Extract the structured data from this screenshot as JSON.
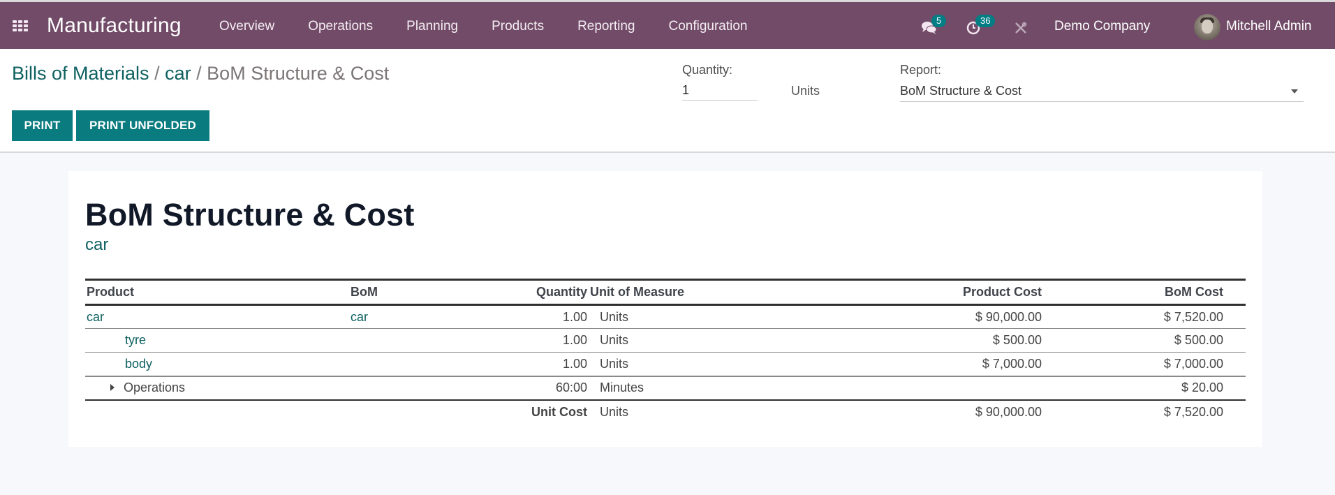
{
  "navbar": {
    "app_name": "Manufacturing",
    "menu": [
      "Overview",
      "Operations",
      "Planning",
      "Products",
      "Reporting",
      "Configuration"
    ],
    "messages_count": "5",
    "activities_count": "36",
    "company": "Demo Company",
    "user": "Mitchell Admin",
    "colors": {
      "navbar_bg": "#714b67",
      "badge_bg": "#017e84"
    }
  },
  "control_panel": {
    "breadcrumb": [
      {
        "label": "Bills of Materials"
      },
      {
        "label": "car"
      },
      {
        "label": "BoM Structure & Cost"
      }
    ],
    "separator": "/",
    "buttons": {
      "print": "PRINT",
      "print_unfolded": "PRINT UNFOLDED"
    },
    "quantity_label": "Quantity:",
    "quantity_value": "1",
    "quantity_uom": "Units",
    "report_label": "Report:",
    "report_value": "BoM Structure & Cost",
    "colors": {
      "button_bg": "#0a7b7f",
      "link": "#0e6061"
    }
  },
  "report": {
    "title": "BoM Structure & Cost",
    "product": "car",
    "columns": [
      "Product",
      "BoM",
      "Quantity",
      "Unit of Measure",
      "Product Cost",
      "BoM Cost"
    ],
    "rows": [
      {
        "product": "car",
        "bom": "car",
        "quantity": "1.00",
        "uom": "Units",
        "product_cost": "$ 90,000.00",
        "bom_cost": "$ 7,520.00"
      },
      {
        "product": "tyre",
        "bom": "",
        "quantity": "1.00",
        "uom": "Units",
        "product_cost": "$ 500.00",
        "bom_cost": "$ 500.00"
      },
      {
        "product": "body",
        "bom": "",
        "quantity": "1.00",
        "uom": "Units",
        "product_cost": "$ 7,000.00",
        "bom_cost": "$ 7,000.00"
      }
    ],
    "operations": {
      "label": "Operations",
      "quantity": "60:00",
      "uom": "Minutes",
      "product_cost": "",
      "bom_cost": "$ 20.00"
    },
    "total": {
      "label": "Unit Cost",
      "uom": "Units",
      "product_cost": "$ 90,000.00",
      "bom_cost": "$ 7,520.00"
    }
  }
}
